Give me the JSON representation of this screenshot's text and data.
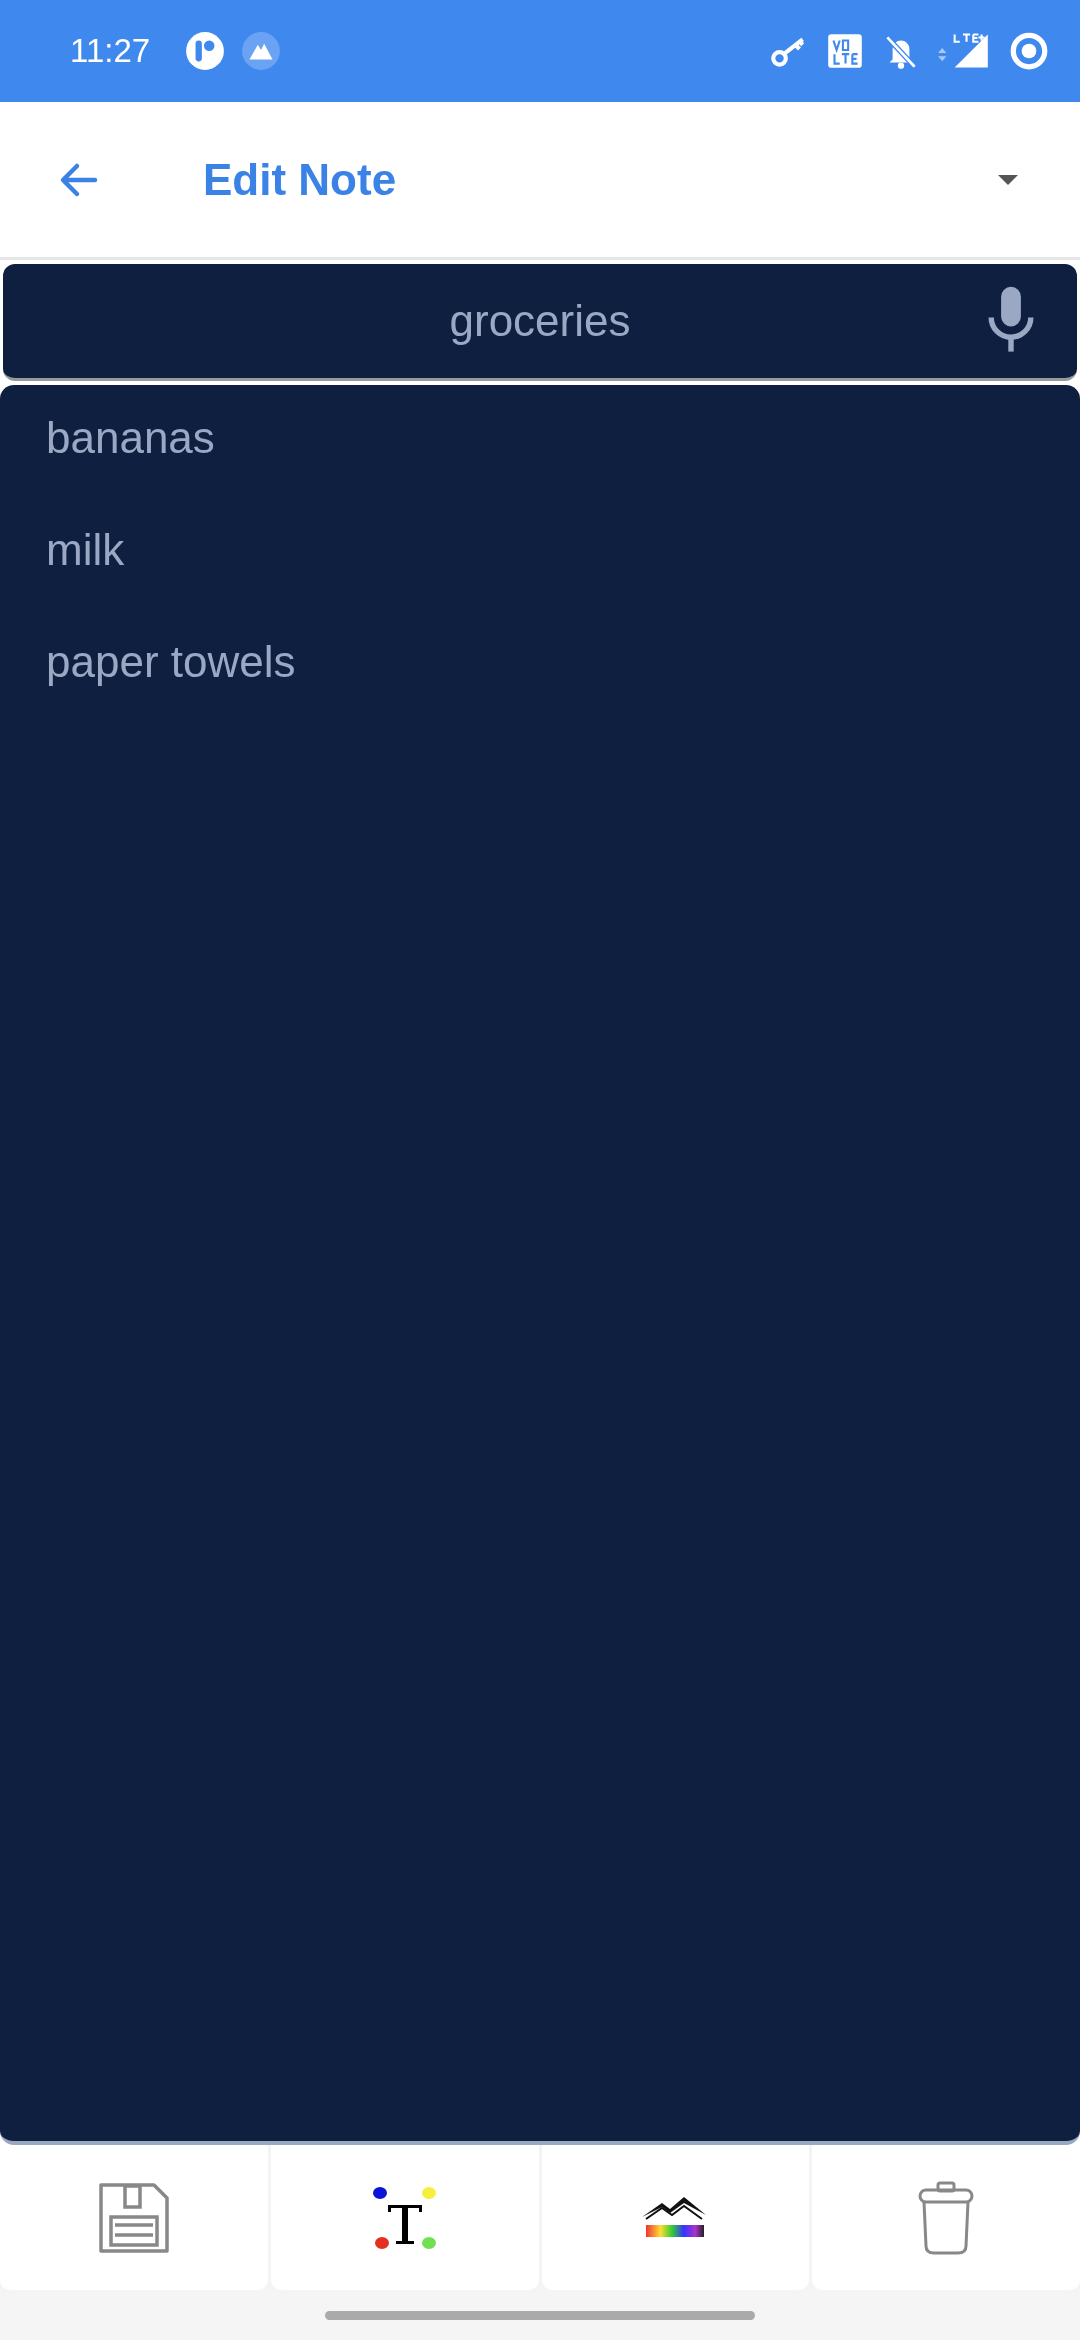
{
  "status_bar": {
    "time": "11:27"
  },
  "app_bar": {
    "title": "Edit Note"
  },
  "title_field": {
    "value": "groceries"
  },
  "note_body": {
    "lines": [
      "bananas",
      "milk",
      "paper towels"
    ]
  },
  "toolbar": [
    {
      "kind": "save"
    },
    {
      "kind": "text-color"
    },
    {
      "kind": "background"
    },
    {
      "kind": "delete"
    }
  ]
}
